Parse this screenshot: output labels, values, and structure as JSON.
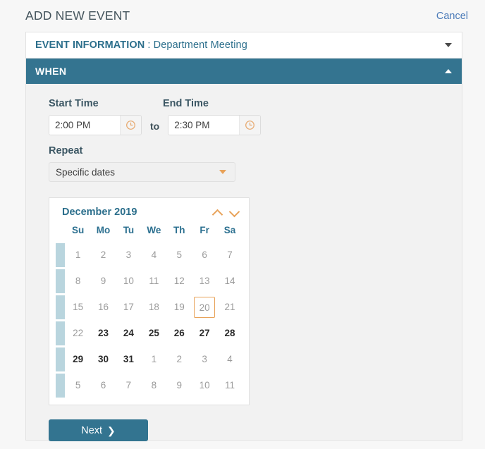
{
  "header": {
    "title": "ADD NEW EVENT",
    "cancel_label": "Cancel"
  },
  "sections": {
    "event_information": {
      "label_bold": "EVENT INFORMATION",
      "label_rest": " : Department Meeting",
      "caret_icon": "chevron-down-icon",
      "expanded": false
    },
    "when": {
      "label": "WHEN",
      "caret_icon": "chevron-up-icon",
      "expanded": true
    }
  },
  "when_form": {
    "start_time": {
      "label": "Start Time",
      "value": "2:00 PM",
      "placeholder": "Start Time",
      "icon": "clock-icon"
    },
    "separator": "to",
    "end_time": {
      "label": "End Time",
      "value": "2:30 PM",
      "placeholder": "End Time",
      "icon": "clock-icon"
    },
    "repeat": {
      "label": "Repeat",
      "value": "Specific dates",
      "caret_icon": "chevron-down-icon"
    },
    "next_button": {
      "label": "Next",
      "arrow": "❯"
    }
  },
  "calendar": {
    "month_year": "December 2019",
    "prev_icon": "chevron-up-icon",
    "next_icon": "chevron-down-icon",
    "weekday_headers": [
      "Su",
      "Mo",
      "Tu",
      "We",
      "Th",
      "Fr",
      "Sa"
    ],
    "today": 20,
    "weeks": [
      [
        {
          "d": "1",
          "active": false
        },
        {
          "d": "2",
          "active": false
        },
        {
          "d": "3",
          "active": false
        },
        {
          "d": "4",
          "active": false
        },
        {
          "d": "5",
          "active": false
        },
        {
          "d": "6",
          "active": false
        },
        {
          "d": "7",
          "active": false
        }
      ],
      [
        {
          "d": "8",
          "active": false
        },
        {
          "d": "9",
          "active": false
        },
        {
          "d": "10",
          "active": false
        },
        {
          "d": "11",
          "active": false
        },
        {
          "d": "12",
          "active": false
        },
        {
          "d": "13",
          "active": false
        },
        {
          "d": "14",
          "active": false
        }
      ],
      [
        {
          "d": "15",
          "active": false
        },
        {
          "d": "16",
          "active": false
        },
        {
          "d": "17",
          "active": false
        },
        {
          "d": "18",
          "active": false
        },
        {
          "d": "19",
          "active": false
        },
        {
          "d": "20",
          "active": false,
          "today": true
        },
        {
          "d": "21",
          "active": false
        }
      ],
      [
        {
          "d": "22",
          "active": false
        },
        {
          "d": "23",
          "active": true
        },
        {
          "d": "24",
          "active": true
        },
        {
          "d": "25",
          "active": true
        },
        {
          "d": "26",
          "active": true
        },
        {
          "d": "27",
          "active": true
        },
        {
          "d": "28",
          "active": true
        }
      ],
      [
        {
          "d": "29",
          "active": true
        },
        {
          "d": "30",
          "active": true
        },
        {
          "d": "31",
          "active": true
        },
        {
          "d": "1",
          "active": false
        },
        {
          "d": "2",
          "active": false
        },
        {
          "d": "3",
          "active": false
        },
        {
          "d": "4",
          "active": false
        }
      ],
      [
        {
          "d": "5",
          "active": false
        },
        {
          "d": "6",
          "active": false
        },
        {
          "d": "7",
          "active": false
        },
        {
          "d": "8",
          "active": false
        },
        {
          "d": "9",
          "active": false
        },
        {
          "d": "10",
          "active": false
        },
        {
          "d": "11",
          "active": false
        }
      ]
    ]
  },
  "colors": {
    "teal": "#347490",
    "teal_text": "#2c6f8c",
    "orange": "#e8a259",
    "link_blue": "#4a7ab8",
    "week_bar": "#b9d5de",
    "page_bg": "#f7f7f7",
    "card_bg": "#f2f2f2"
  }
}
